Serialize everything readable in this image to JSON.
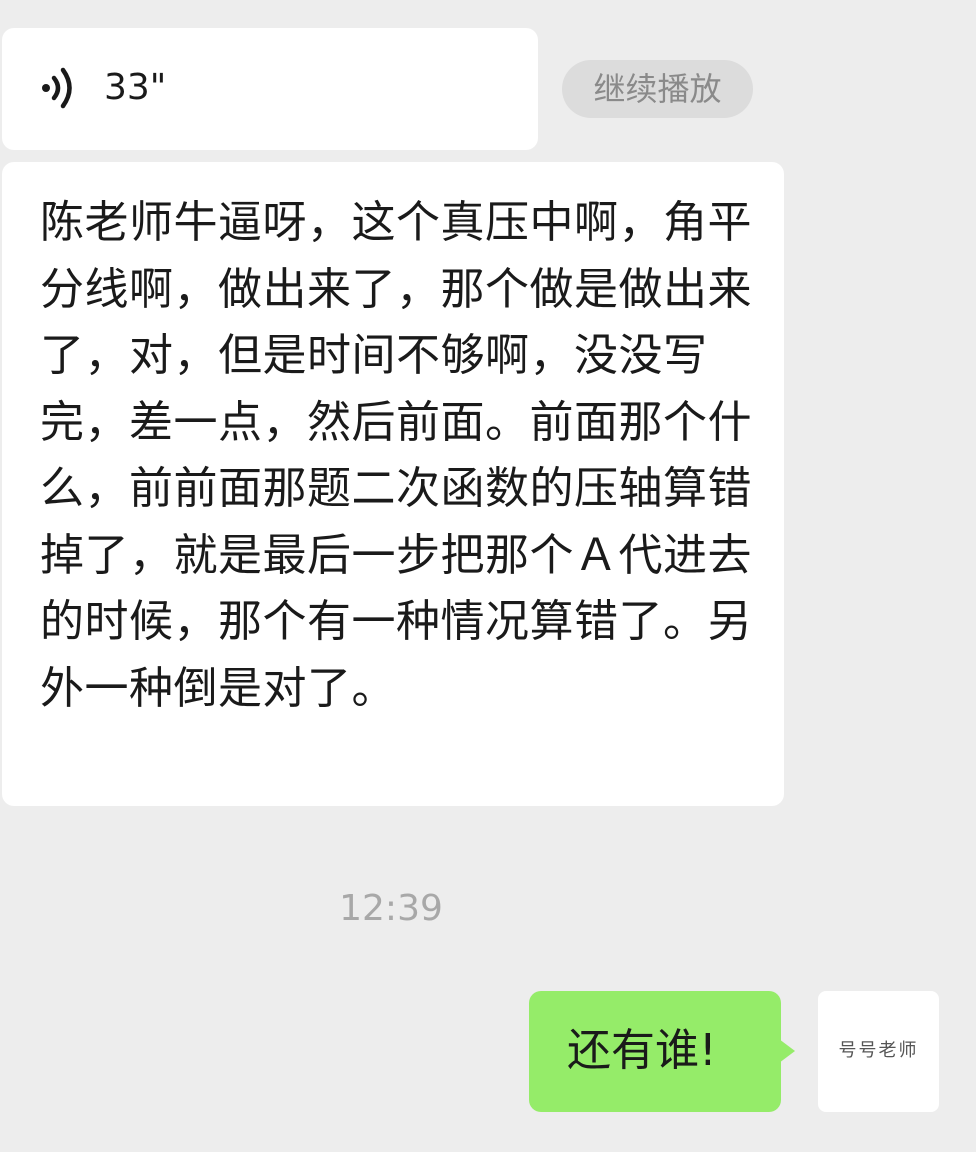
{
  "messages": {
    "voice": {
      "duration": "33\"",
      "icon": "voice-wave-icon",
      "continue_label": "继续播放"
    },
    "transcript": {
      "text": "陈老师牛逼呀，这个真压中啊，角平分线啊，做出来了，那个做是做出来了，对，但是时间不够啊，没没写完，差一点，然后前面。前面那个什么，前前面那题二次函数的压轴算错掉了，就是最后一步把那个Ａ代进去的时候，那个有一种情况算错了。另外一种倒是对了。"
    },
    "timestamp": "12:39",
    "sent": {
      "text": "还有谁!",
      "bubble_color": "#95ec69"
    },
    "avatar": {
      "text": "号号老师"
    }
  },
  "colors": {
    "background": "#ededed",
    "bubble_received": "#ffffff",
    "bubble_sent": "#95ec69",
    "timestamp": "#a8a8a8",
    "continue_button_bg": "#dcdcdc"
  }
}
